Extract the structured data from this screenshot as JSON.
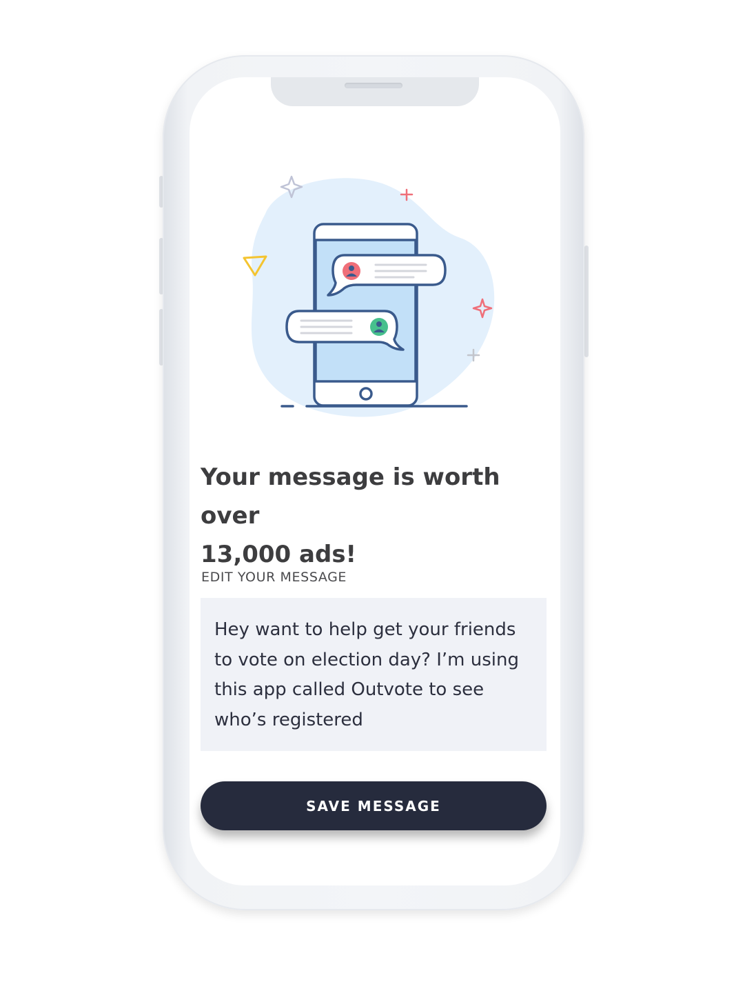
{
  "headline": {
    "line1": "Your message is worth over",
    "line2": "13,000 ads!"
  },
  "edit_section": {
    "label": "EDIT YOUR MESSAGE",
    "message_text": "Hey want to help get your friends to vote on election day? I’m using this app called Outvote to see who’s registered"
  },
  "save_button": {
    "label": "SAVE MESSAGE"
  },
  "illustration": {
    "icon": "phone-chat-bubbles-illustration"
  },
  "colors": {
    "headline": "#3d3d3f",
    "message_box_bg": "#f0f2f7",
    "message_text": "#2c2f3e",
    "button_bg": "#262b3d",
    "button_text": "#ffffff",
    "illustration_outline": "#3a5a8c",
    "illustration_blob": "#e3f0fc",
    "accent_red": "#ef6f79",
    "accent_green": "#47c08d",
    "accent_yellow": "#f4c430"
  }
}
